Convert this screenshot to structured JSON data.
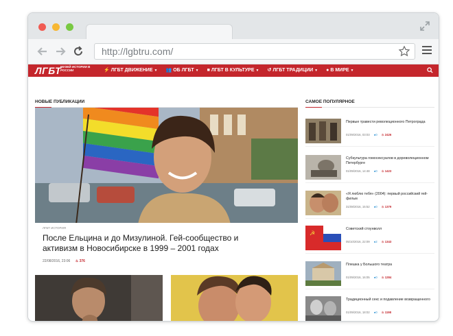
{
  "browser": {
    "url": "http://lgbtru.com/"
  },
  "site": {
    "logo_main": "ЛГБТ",
    "logo_sub": "МУЗЕЙ ИСТОРИИ В РОССИИ",
    "nav": [
      {
        "label": "ЛГБТ ДВИЖЕНИЕ",
        "icon": "bolt-icon"
      },
      {
        "label": "ОБ ЛГБТ",
        "icon": "users-icon"
      },
      {
        "label": "ЛГБТ В КУЛЬТУРЕ",
        "icon": "video-icon"
      },
      {
        "label": "ЛГБТ ТРАДИЦИИ",
        "icon": "history-icon"
      },
      {
        "label": "В МИРЕ",
        "icon": "globe-icon"
      }
    ],
    "accent_color": "#c4262c"
  },
  "sections": {
    "new_heading": "НОВЫЕ ПУБЛИКАЦИИ",
    "popular_heading": "САМОЕ ПОПУЛЯРНОЕ"
  },
  "featured": {
    "category": "ЛГБТ ИСТОРИЯ",
    "title": "После Ельцина и до Мизулиной. Гей-сообщество и активизм в Новосибирске в 1999 – 2001 годах",
    "date": "22/08/2016, 23:06",
    "hot": "376"
  },
  "popular": [
    {
      "title": "Первые травести революционного Петрограда",
      "date": "01/09/2016, 03:03",
      "comments": "0",
      "hot": "2426"
    },
    {
      "title": "Субкультура гомосексуалов в дореволюционном Петербурге",
      "date": "01/09/2016, 14:48",
      "comments": "0",
      "hot": "1423"
    },
    {
      "title": "«Я люблю тебя» (2004): первый российский гей-фильм",
      "date": "31/08/2016, 15:52",
      "comments": "0",
      "hot": "1379"
    },
    {
      "title": "Советский стоунволл",
      "date": "05/10/2016, 22:09",
      "comments": "2",
      "hot": "1343"
    },
    {
      "title": "Плешка у Большого театра",
      "date": "01/09/2016, 16:05",
      "comments": "0",
      "hot": "1284"
    },
    {
      "title": "Традиционный секс и подавление возвращенного",
      "date": "01/09/2016, 18:02",
      "comments": "0",
      "hot": "1198"
    }
  ]
}
